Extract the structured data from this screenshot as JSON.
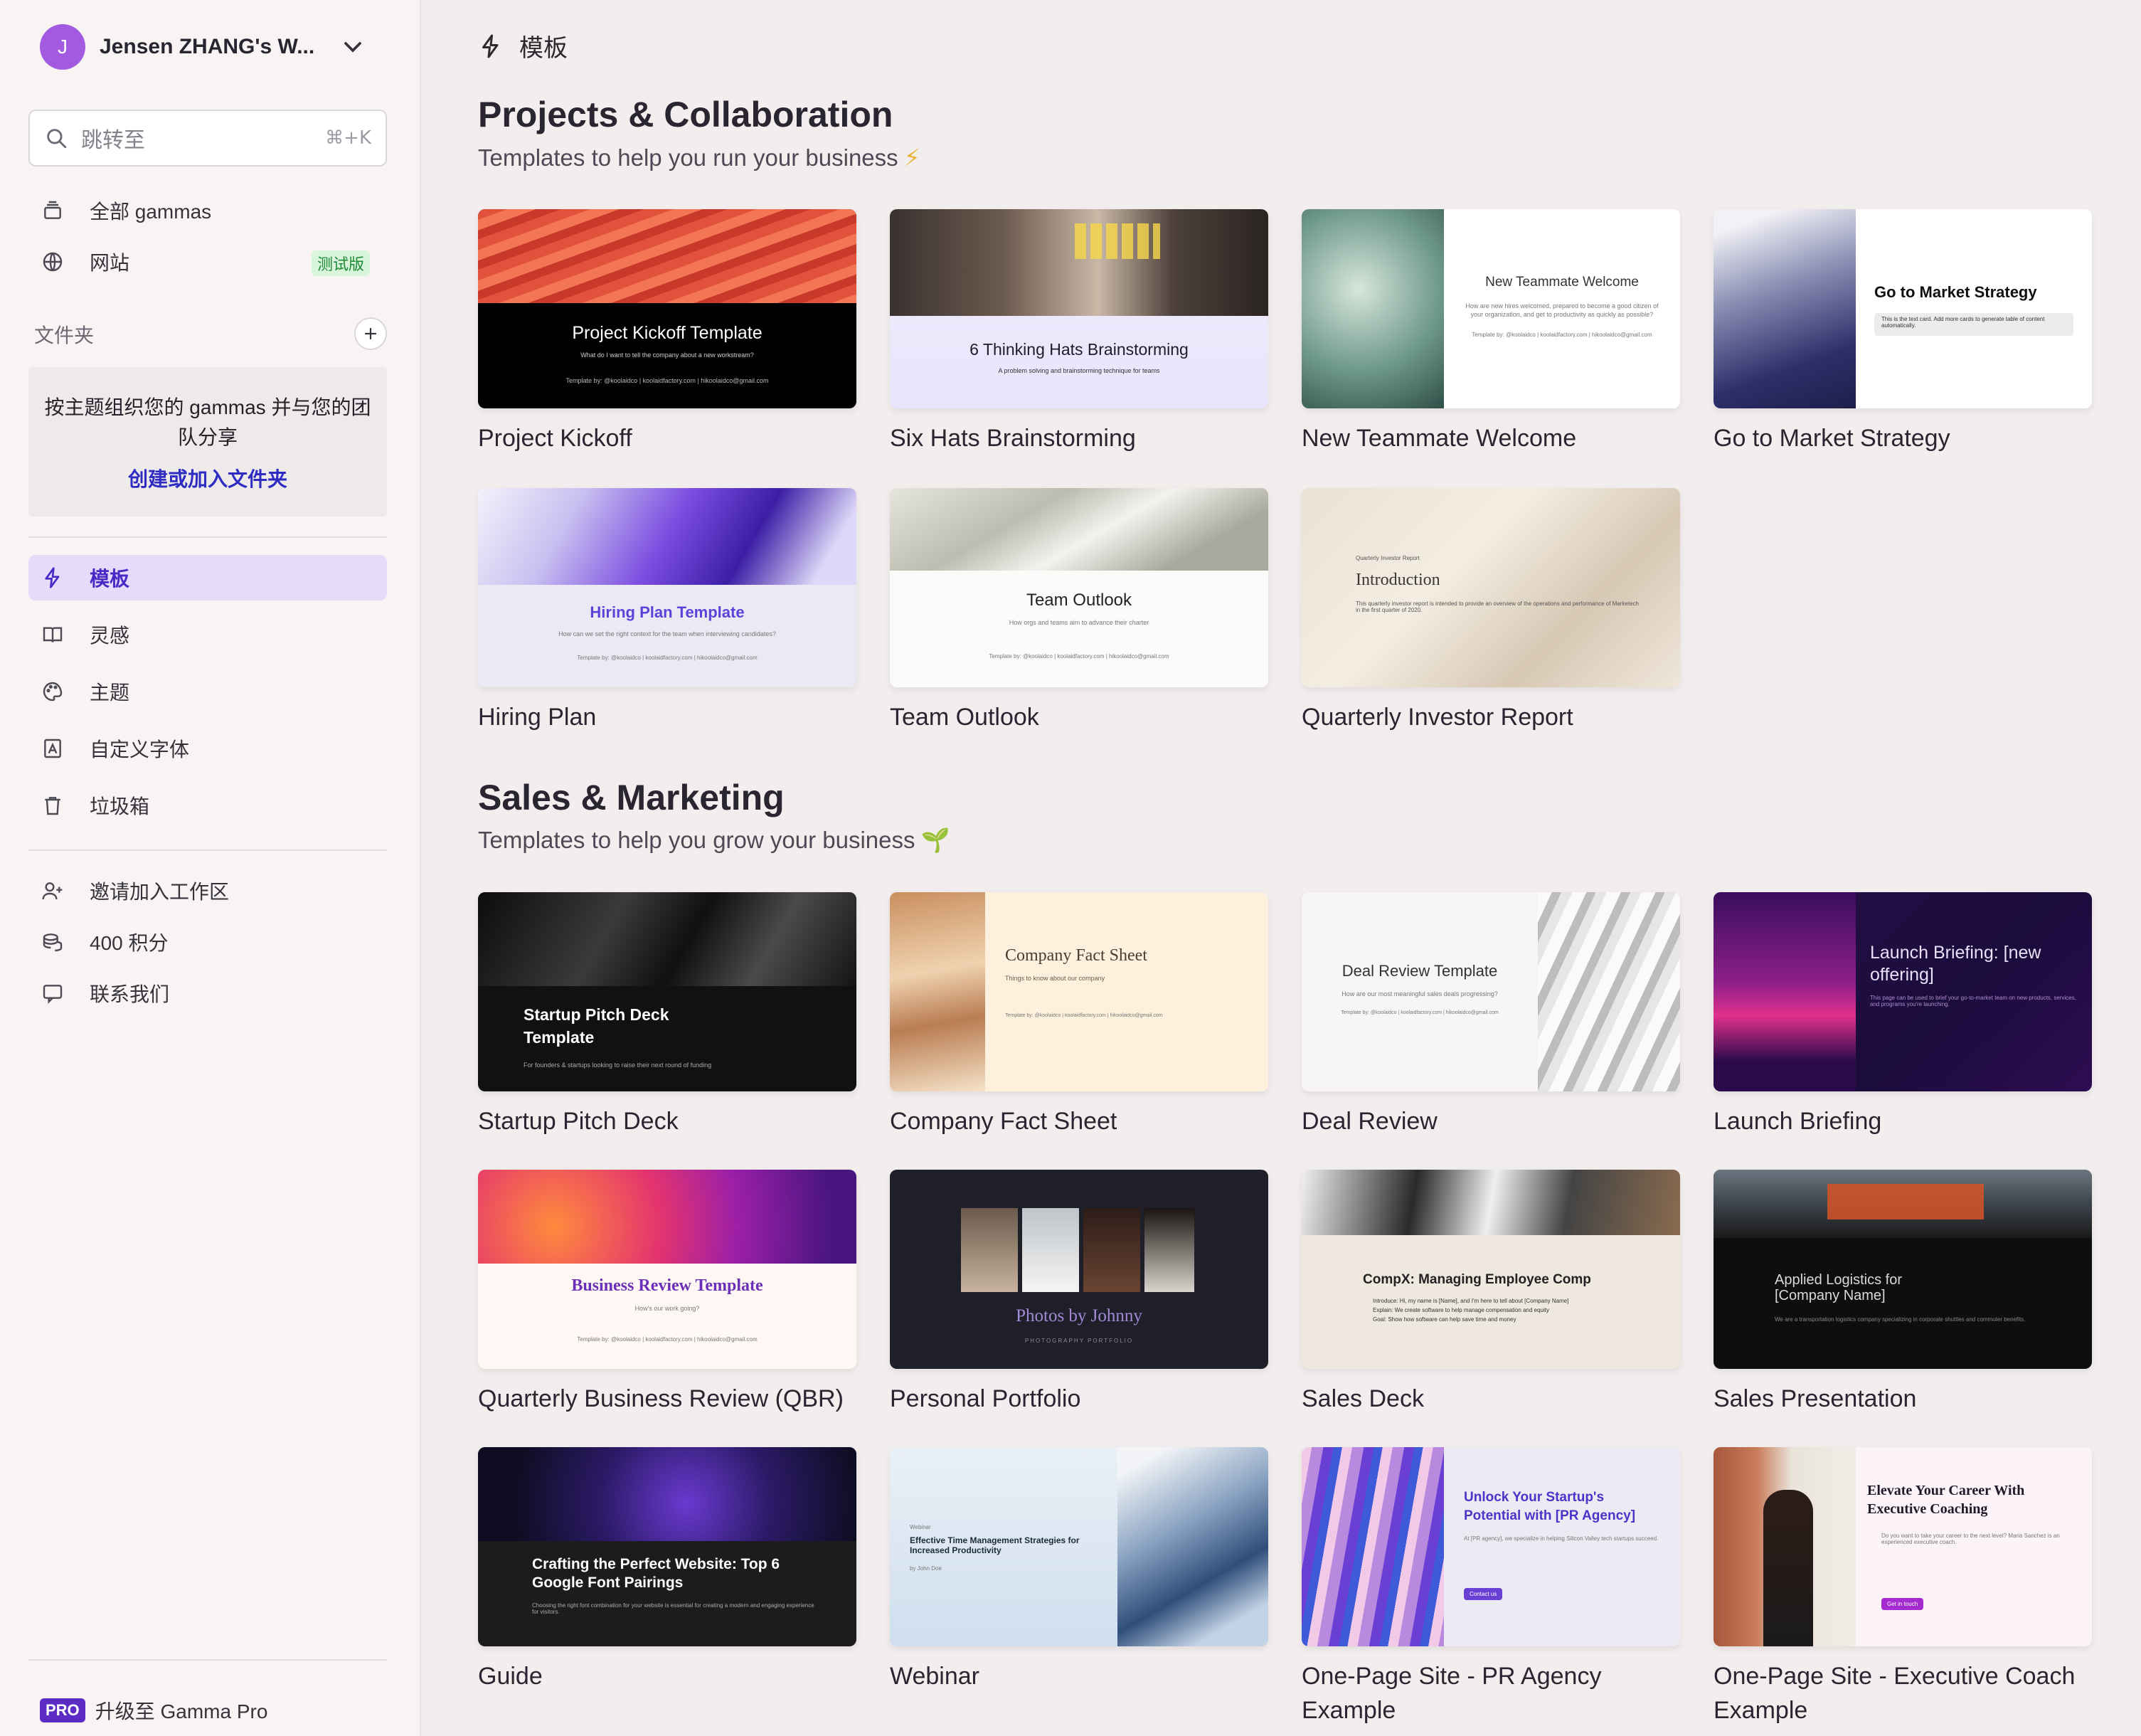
{
  "sidebar": {
    "workspace": {
      "initial": "J",
      "name": "Jensen ZHANG's W..."
    },
    "search": {
      "placeholder": "跳转至",
      "shortcut": "⌘+K"
    },
    "nav_top": [
      {
        "label": "全部 gammas",
        "icon": "stack-icon"
      },
      {
        "label": "网站",
        "icon": "globe-icon",
        "badge": "测试版"
      }
    ],
    "folders": {
      "header": "文件夹",
      "empty_text": "按主题组织您的 gammas 并与您的团队分享",
      "link": "创建或加入文件夹"
    },
    "nav_main": [
      {
        "label": "模板",
        "icon": "bolt-icon",
        "active": true
      },
      {
        "label": "灵感",
        "icon": "book-icon"
      },
      {
        "label": "主题",
        "icon": "palette-icon"
      },
      {
        "label": "自定义字体",
        "icon": "font-icon"
      },
      {
        "label": "垃圾箱",
        "icon": "trash-icon"
      }
    ],
    "nav_bottom": [
      {
        "label": "邀请加入工作区",
        "icon": "user-plus-icon"
      },
      {
        "label": "400 积分",
        "icon": "coins-icon"
      },
      {
        "label": "联系我们",
        "icon": "chat-icon"
      }
    ],
    "upgrade": {
      "badge": "PRO",
      "label": "升级至 Gamma Pro"
    }
  },
  "header": {
    "title": "模板",
    "icon": "bolt-icon"
  },
  "sections": [
    {
      "title": "Projects & Collaboration",
      "subtitle": "Templates to help you run your business",
      "emoji": "⚡",
      "cards": [
        {
          "label": "Project Kickoff",
          "thumb_title": "Project Kickoff Template",
          "thumb_sub": "What do I want to tell the company about a new workstream?",
          "thumb_credit": "Template by: @koolaidco | koolaidfactory.com | hikoolaidco@gmail.com"
        },
        {
          "label": "Six Hats Brainstorming",
          "thumb_title": "6 Thinking Hats Brainstorming",
          "thumb_sub": "A problem solving and brainstorming technique for teams"
        },
        {
          "label": "New Teammate Welcome",
          "thumb_title": "New Teammate Welcome",
          "thumb_sub": "How are new hires welcomed, prepared to become a good citizen of your organization, and get to productivity as quickly as possible?",
          "thumb_credit": "Template by: @koolaidco | koolaidfactory.com | hikoolaidco@gmail.com"
        },
        {
          "label": "Go to Market Strategy",
          "thumb_title": "Go to Market Strategy",
          "thumb_sub": "This is the text card. Add more cards to generate table of content automatically."
        },
        {
          "label": "Hiring Plan",
          "thumb_title": "Hiring Plan Template",
          "thumb_sub": "How can we set the right context for the team when interviewing candidates?",
          "thumb_credit": "Template by: @koolaidco | koolaidfactory.com | hikoolaidco@gmail.com"
        },
        {
          "label": "Team Outlook",
          "thumb_title": "Team Outlook",
          "thumb_sub": "How orgs and teams aim to advance their charter",
          "thumb_credit": "Template by: @koolaidco | koolaidfactory.com | hikoolaidco@gmail.com"
        },
        {
          "label": "Quarterly Investor Report",
          "thumb_kicker": "Quarterly Investor Report",
          "thumb_title": "Introduction",
          "thumb_sub": "This quarterly investor report is intended to provide an overview of the operations and performance of Marketech in the first quarter of 2020."
        }
      ]
    },
    {
      "title": "Sales & Marketing",
      "subtitle": "Templates to help you grow your business",
      "emoji": "🌱",
      "cards": [
        {
          "label": "Startup Pitch Deck",
          "thumb_title": "Startup Pitch Deck Template",
          "thumb_sub": "For founders & startups looking to raise their next round of funding"
        },
        {
          "label": "Company Fact Sheet",
          "thumb_title": "Company Fact Sheet",
          "thumb_sub": "Things to know about our company",
          "thumb_credit": "Template by: @koolaidco | koolaidfactory.com | hikoolaidco@gmail.com"
        },
        {
          "label": "Deal Review",
          "thumb_title": "Deal Review Template",
          "thumb_sub": "How are our most meaningful sales deals progressing?",
          "thumb_credit": "Template by: @koolaidco | koolaidfactory.com | hikoolaidco@gmail.com"
        },
        {
          "label": "Launch Briefing",
          "thumb_title": "Launch Briefing: [new offering]",
          "thumb_sub": "This page can be used to brief your go-to-market team on new products, services, and programs you're launching."
        },
        {
          "label": "Quarterly Business Review (QBR)",
          "thumb_title": "Business Review Template",
          "thumb_sub": "How's our work going?",
          "thumb_credit": "Template by: @koolaidco | koolaidfactory.com | hikoolaidco@gmail.com"
        },
        {
          "label": "Personal Portfolio",
          "thumb_title": "Photos by Johnny",
          "thumb_sub": "PHOTOGRAPHY PORTFOLIO"
        },
        {
          "label": "Sales Deck",
          "thumb_title": "CompX: Managing Employee Comp",
          "thumb_bullets": [
            "Introduce: Hi, my name is [Name], and I'm here to tell about [Company Name]",
            "Explain: We create software to help manage compensation and equity",
            "Goal: Show how software can help save time and money"
          ]
        },
        {
          "label": "Sales Presentation",
          "thumb_title": "Applied Logistics for [Company Name]",
          "thumb_sub": "We are a transportation logistics company specializing in corporate shuttles and commuter benefits."
        },
        {
          "label": "Guide",
          "thumb_title": "Crafting the Perfect Website: Top 6 Google Font Pairings",
          "thumb_sub": "Choosing the right font combination for your website is essential for creating a modern and engaging experience for visitors."
        },
        {
          "label": "Webinar",
          "thumb_kicker": "Webinar",
          "thumb_title": "Effective Time Management Strategies for Increased Productivity",
          "thumb_sub": "by John Doe"
        },
        {
          "label": "One-Page Site - PR Agency Example",
          "thumb_title": "Unlock Your Startup's Potential with [PR Agency]",
          "thumb_sub": "At [PR agency], we specialize in helping Silicon Valley tech startups succeed.",
          "thumb_button": "Contact us"
        },
        {
          "label": "One-Page Site - Executive Coach Example",
          "thumb_title": "Elevate Your Career With Executive Coaching",
          "thumb_sub": "Do you want to take your career to the next level? Maria Sanchez is an experienced executive coach.",
          "thumb_button": "Get in touch"
        }
      ]
    }
  ],
  "colors": {
    "accent": "#4a29c7",
    "active_bg": "#e5dcfb",
    "page_bg": "#f3eeee",
    "sidebar_bg": "#f7f4f3"
  }
}
